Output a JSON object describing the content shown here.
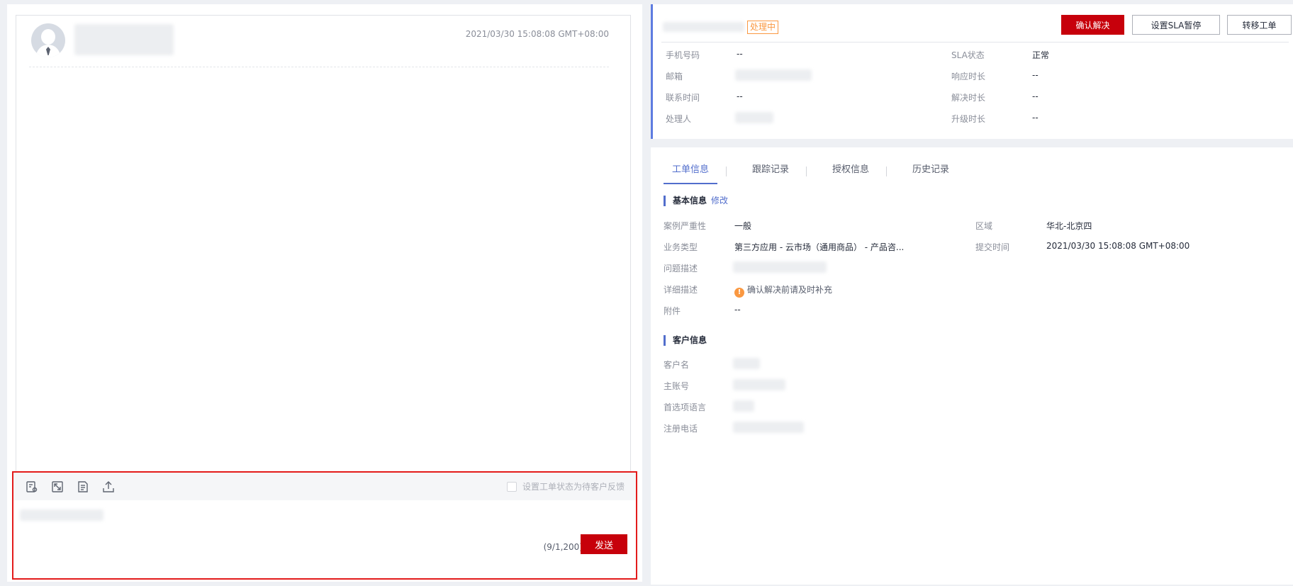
{
  "chat": {
    "message_time": "2021/03/30 15:08:08 GMT+08:00"
  },
  "composer": {
    "pending_label": "设置工单状态为待客户反馈",
    "counter": "(9/1,200)",
    "send_label": "发送",
    "tools": [
      "preview-icon",
      "fullscreen-icon",
      "template-icon",
      "upload-icon"
    ]
  },
  "ticket": {
    "status": "处理中",
    "confirm_label": "确认解决",
    "sla_pause_label": "设置SLA暂停",
    "transfer_label": "转移工单",
    "fields": {
      "phone_label": "手机号码",
      "phone_value": "--",
      "email_label": "邮箱",
      "contact_time_label": "联系时间",
      "contact_time_value": "--",
      "handler_label": "处理人",
      "sla_label": "SLA状态",
      "sla_value": "正常",
      "response_label": "响应时长",
      "response_value": "--",
      "resolve_label": "解决时长",
      "resolve_value": "--",
      "escalate_label": "升级时长",
      "escalate_value": "--"
    }
  },
  "tabs": [
    "工单信息",
    "跟踪记录",
    "授权信息",
    "历史记录"
  ],
  "basic_info": {
    "title": "基本信息",
    "edit_label": "修改",
    "severity_label": "案例严重性",
    "severity_value": "一般",
    "biz_type_label": "业务类型",
    "biz_type_value": "第三方应用 - 云市场（通用商品） - 产品咨...",
    "problem_label": "问题描述",
    "detail_label": "详细描述",
    "detail_value": "确认解决前请及时补充",
    "attachment_label": "附件",
    "attachment_value": "--",
    "region_label": "区域",
    "region_value": "华北-北京四",
    "submit_time_label": "提交时间",
    "submit_time_value": "2021/03/30 15:08:08 GMT+08:00"
  },
  "customer_info": {
    "title": "客户信息",
    "name_label": "客户名",
    "account_label": "主账号",
    "language_label": "首选项语言",
    "phone_label": "注册电话"
  },
  "colors": {
    "primary_red": "#c7000b",
    "accent_blue": "#526ecc",
    "status_orange": "#fa9841",
    "highlight_red": "#e31b1b"
  }
}
